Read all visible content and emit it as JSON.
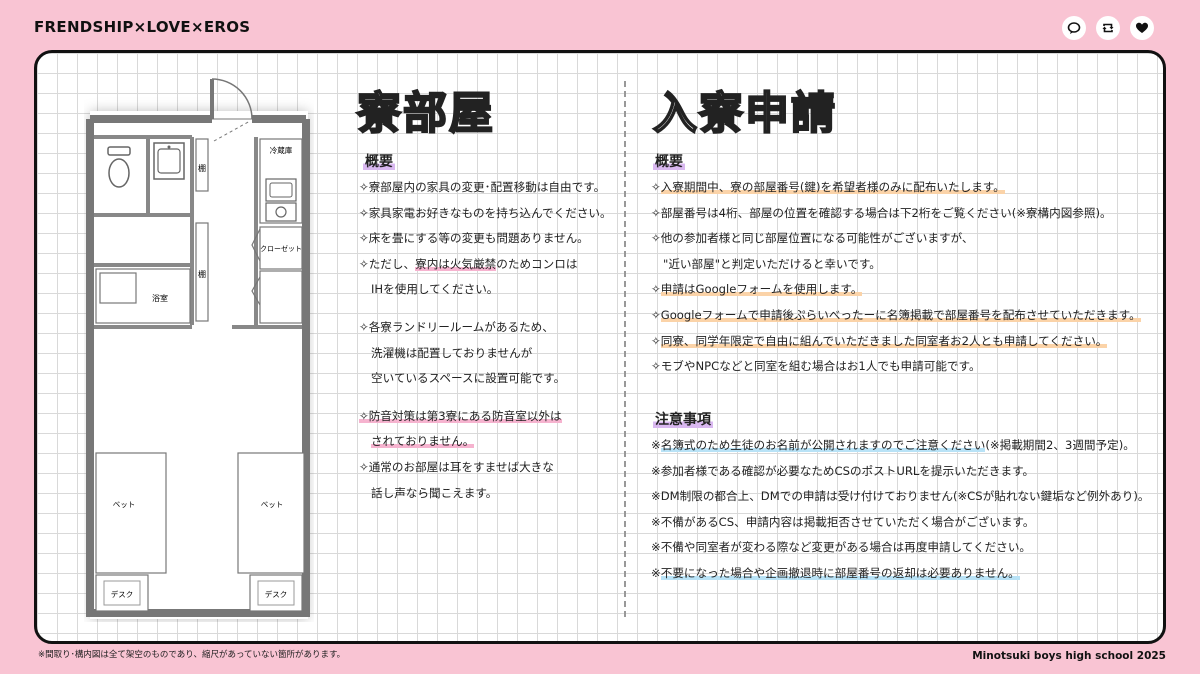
{
  "header": {
    "brand": "FRENDSHIP×LOVE×EROS"
  },
  "icons": [
    "speech-bubble-icon",
    "repost-icon",
    "heart-icon"
  ],
  "floorplan": {
    "labels": {
      "shelf1": "棚",
      "fridge": "冷蔵庫",
      "closet": "クローゼット",
      "shelf2": "棚",
      "bath": "浴室",
      "bed_left": "ベット",
      "bed_right": "ベット",
      "desk_left": "デスク",
      "desk_right": "デスク"
    }
  },
  "left": {
    "title": "寮部屋",
    "heading": "概要",
    "lines": [
      "✧寮部屋内の家具の変更･配置移動は自由です。",
      "✧家具家電お好きなものを持ち込んでください。",
      "✧床を畳にする等の変更も問題ありません。",
      "✧ただし、",
      "寮内は火気厳禁",
      "のためコンロは",
      "IHを使用してください。",
      "✧各寮ランドリールームがあるため、",
      "洗濯機は配置しておりませんが",
      "空いているスペースに設置可能です。",
      "✧防音対策は第3寮にある防音室以外は",
      "されておりません。",
      "✧通常のお部屋は耳をすませば大きな",
      "話し声なら聞こえます。"
    ]
  },
  "right": {
    "title": "入寮申請",
    "heading1": "概要",
    "lines1": [
      "✧",
      "入寮期間中、寮の部屋番号(鍵)を希望者様のみに配布いたします。",
      "✧部屋番号は4桁、部屋の位置を確認する場合は下2桁をご覧ください(※寮構内図参照)。",
      "✧他の参加者様と同じ部屋位置になる可能性がございますが、",
      "\"近い部屋\"と判定いただけると幸いです。",
      "✧",
      "申請はGoogleフォームを使用します。",
      "✧",
      "Googleフォームで申請後ぷらいべったーに名簿掲載で部屋番号を配布させていただきます。",
      "✧",
      "同寮、同学年限定で自由に組んでいただきました同室者お2人とも申請してください。",
      "✧モブやNPCなどと同室を組む場合はお1人でも申請可能です。"
    ],
    "heading2": "注意事項",
    "lines2": [
      "※",
      "名簿式のため生徒のお名前が公開されますのでご注意ください",
      "(※掲載期間2、3週間予定)。",
      "※参加者様である確認が必要なためCSのポストURLを提示いただきます。",
      "※DM制限の都合上、DMでの申請は受け付けておりません(※CSが貼れない鍵垢など例外あり)。",
      "※不備があるCS、申請内容は掲載拒否させていただく場合がございます。",
      "※不備や同室者が変わる際など変更がある場合は再度申請してください。",
      "※",
      "不要になった場合や企画撤退時に部屋番号の返却は必要ありません。"
    ]
  },
  "footer": {
    "note": "※間取り･構内図は全て架空のものであり、縮尺があっていない箇所があります。",
    "school": "Minotsuki boys high school 2025"
  }
}
